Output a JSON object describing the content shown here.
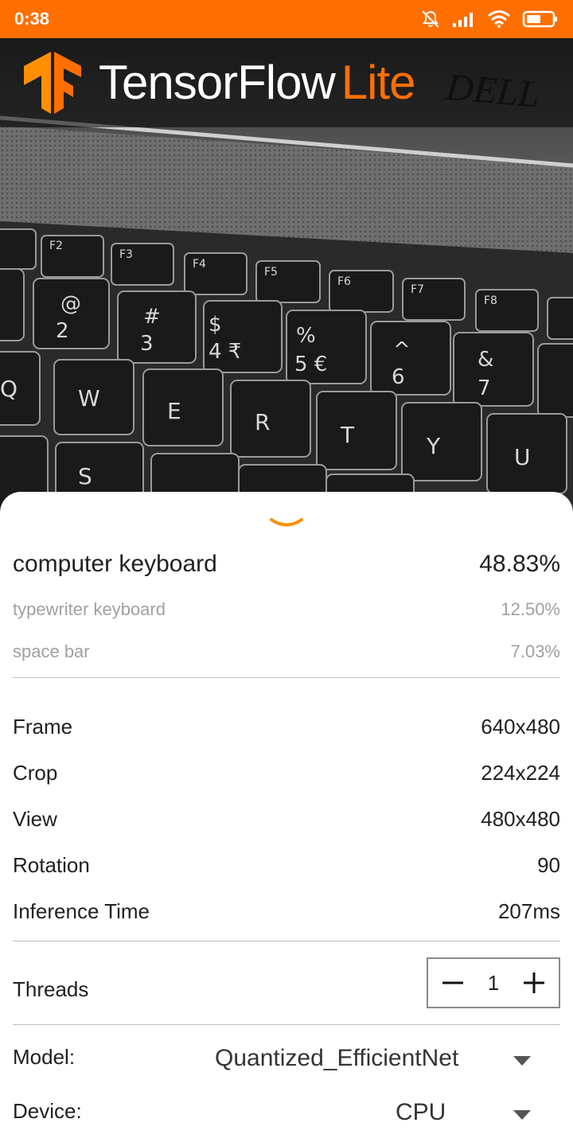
{
  "status_bar": {
    "time": "0:38",
    "icons": [
      "alarm-off-icon",
      "signal-icon",
      "wifi-icon",
      "battery-icon"
    ]
  },
  "toolbar": {
    "logo": "tensorflow-logo",
    "brand_primary": "TensorFlow",
    "brand_accent": "Lite"
  },
  "colors": {
    "accent": "#ff6f00",
    "text_primary": "#212121",
    "text_secondary": "#a0a0a0"
  },
  "results": {
    "top": {
      "label": "computer keyboard",
      "score": "48.83%"
    },
    "others": [
      {
        "label": "typewriter keyboard",
        "score": "12.50%"
      },
      {
        "label": "space bar",
        "score": "7.03%"
      }
    ]
  },
  "info": [
    {
      "label": "Frame",
      "value": "640x480"
    },
    {
      "label": "Crop",
      "value": "224x224"
    },
    {
      "label": "View",
      "value": "480x480"
    },
    {
      "label": "Rotation",
      "value": "90"
    },
    {
      "label": "Inference Time",
      "value": "207ms"
    }
  ],
  "threads": {
    "label": "Threads",
    "value": "1"
  },
  "model": {
    "label": "Model:",
    "selected": "Quantized_EfficientNet"
  },
  "device": {
    "label": "Device:",
    "selected": "CPU"
  }
}
